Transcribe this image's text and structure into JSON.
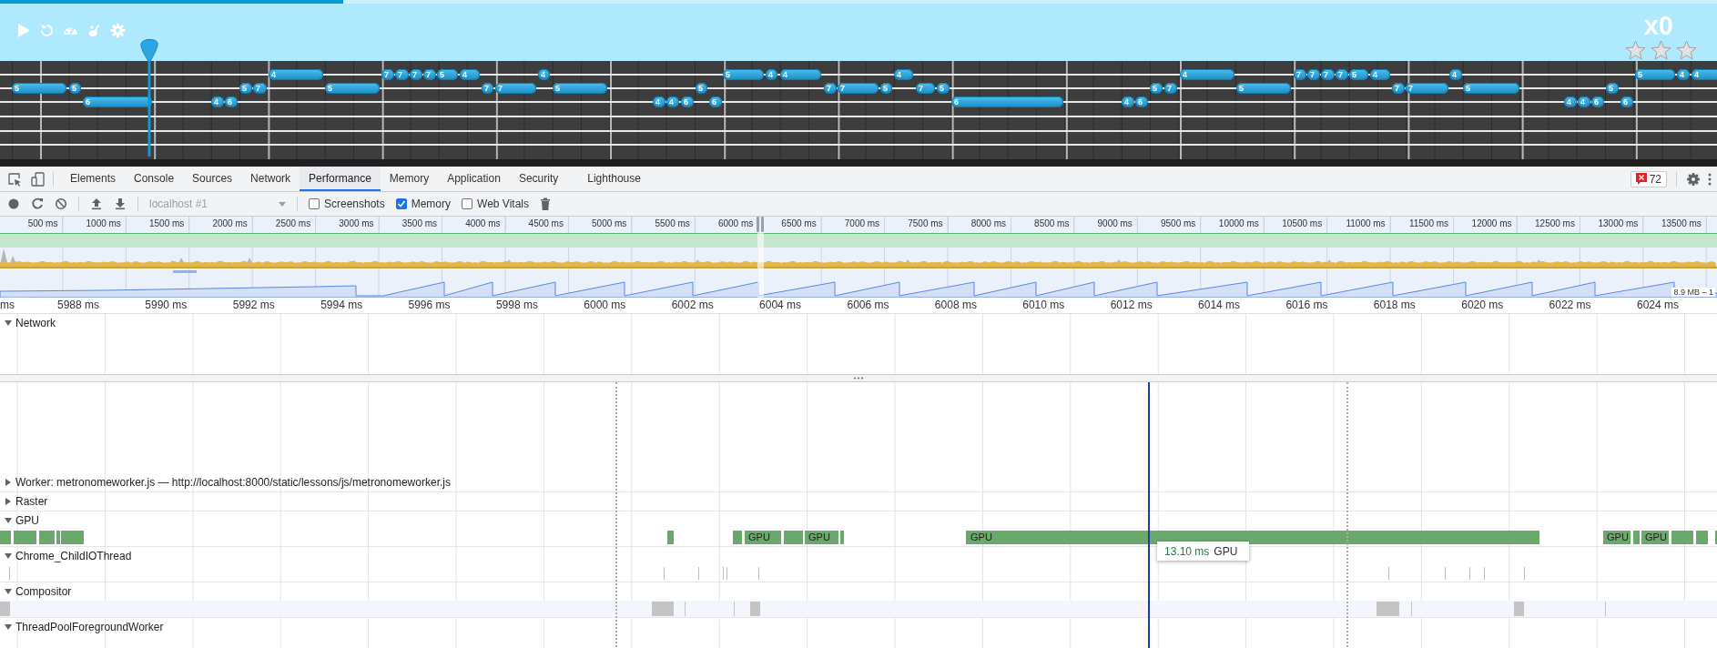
{
  "game": {
    "progress": {
      "level": 0.2
    },
    "score": "x0",
    "rating": {
      "stars": 0
    },
    "strings": [
      {
        "notes": [
          {
            "fret": "4"
          },
          {
            "fret": "7"
          },
          {
            "fret": "7"
          },
          {
            "fret": "7"
          },
          {
            "fret": "7"
          },
          {
            "fret": "5"
          },
          {
            "fret": "4"
          },
          {
            "fret": "4"
          },
          {
            "fret": "5"
          },
          {
            "fret": "4"
          },
          {
            "fret": "4"
          },
          {
            "fret": "4"
          },
          {
            "fret": "4"
          },
          {
            "fret": "7"
          },
          {
            "fret": "7"
          },
          {
            "fret": "7"
          },
          {
            "fret": "7"
          },
          {
            "fret": "5"
          },
          {
            "fret": "4"
          },
          {
            "fret": "4"
          },
          {
            "fret": "5"
          },
          {
            "fret": "4"
          },
          {
            "fret": "4"
          }
        ]
      },
      {
        "notes": [
          {
            "fret": "5"
          },
          {
            "fret": "5"
          },
          {
            "fret": "5"
          },
          {
            "fret": "7"
          },
          {
            "fret": "5"
          },
          {
            "fret": "7"
          },
          {
            "fret": "7"
          },
          {
            "fret": "5"
          },
          {
            "fret": "5"
          },
          {
            "fret": "7"
          },
          {
            "fret": "7"
          },
          {
            "fret": "5"
          },
          {
            "fret": "7"
          },
          {
            "fret": "5"
          },
          {
            "fret": "5"
          },
          {
            "fret": "7"
          },
          {
            "fret": "5"
          },
          {
            "fret": "7"
          },
          {
            "fret": "7"
          },
          {
            "fret": "5"
          },
          {
            "fret": "5"
          }
        ]
      },
      {
        "notes": [
          {
            "fret": "6"
          },
          {
            "fret": "4"
          },
          {
            "fret": "6"
          },
          {
            "fret": "4"
          },
          {
            "fret": "4"
          },
          {
            "fret": "6"
          },
          {
            "fret": "6"
          },
          {
            "fret": "6"
          },
          {
            "fret": "4"
          },
          {
            "fret": "6"
          },
          {
            "fret": "4"
          },
          {
            "fret": "4"
          },
          {
            "fret": "6"
          },
          {
            "fret": "6"
          }
        ]
      }
    ]
  },
  "devtools": {
    "tabs": [
      {
        "label": "Elements",
        "selected": false
      },
      {
        "label": "Console",
        "selected": false
      },
      {
        "label": "Sources",
        "selected": false
      },
      {
        "label": "Network",
        "selected": false
      },
      {
        "label": "Performance",
        "selected": true
      },
      {
        "label": "Memory",
        "selected": false
      },
      {
        "label": "Application",
        "selected": false
      },
      {
        "label": "Security",
        "selected": false
      },
      {
        "label": "Lighthouse",
        "selected": false
      }
    ],
    "error_count": "72",
    "toolbar": {
      "target": "localhost #1",
      "options": [
        {
          "label": "Screenshots",
          "checked": false
        },
        {
          "label": "Memory",
          "checked": true
        },
        {
          "label": "Web Vitals",
          "checked": false
        }
      ]
    },
    "overview": {
      "ticks": [
        "500 ms",
        "1000 ms",
        "1500 ms",
        "2000 ms",
        "2500 ms",
        "3000 ms",
        "3500 ms",
        "4000 ms",
        "4500 ms",
        "5000 ms",
        "5500 ms",
        "6000 ms",
        "6500 ms",
        "7000 ms",
        "7500 ms",
        "8000 ms",
        "8500 ms",
        "9000 ms",
        "9500 ms",
        "10000 ms",
        "10500 ms",
        "11000 ms",
        "11500 ms",
        "12000 ms",
        "12500 ms",
        "13000 ms",
        "13500 ms"
      ],
      "memory_range": "8.9 MB – 1"
    },
    "timeline": {
      "ticks": [
        "ms",
        "5988 ms",
        "5990 ms",
        "5992 ms",
        "5994 ms",
        "5996 ms",
        "5998 ms",
        "6000 ms",
        "6002 ms",
        "6004 ms",
        "6006 ms",
        "6008 ms",
        "6010 ms",
        "6012 ms",
        "6014 ms",
        "6016 ms",
        "6018 ms",
        "6020 ms",
        "6022 ms",
        "6024 ms"
      ]
    },
    "network": {
      "label": "Network",
      "expanded": true
    },
    "tracks": [
      {
        "label": "Worker: metronomeworker.js — http://localhost:8000/static/lessons/js/metronomeworker.js",
        "expanded": false
      },
      {
        "label": "Raster",
        "expanded": false
      },
      {
        "label": "GPU",
        "expanded": true,
        "events": [
          {
            "label": "GPU"
          },
          {
            "label": "GPU"
          },
          {
            "label": "GPU"
          },
          {
            "label": "GPU"
          },
          {
            "label": "GPU"
          }
        ]
      },
      {
        "label": "Chrome_ChildIOThread",
        "expanded": true
      },
      {
        "label": "Compositor",
        "expanded": true
      },
      {
        "label": "ThreadPoolForegroundWorker",
        "expanded": true
      }
    ],
    "tooltip": {
      "duration": "13.10 ms",
      "name": "GPU"
    }
  }
}
